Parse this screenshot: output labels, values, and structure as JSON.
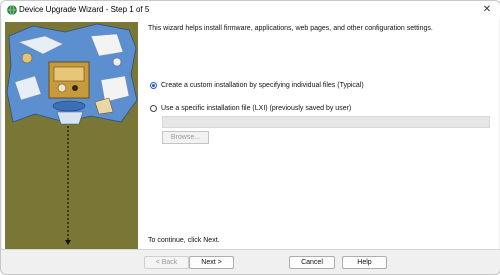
{
  "window": {
    "title": "Device Upgrade Wizard - Step 1 of 5",
    "close_glyph": "✕",
    "title_icon": "globe-icon"
  },
  "main": {
    "intro": "This wizard helps install firmware, applications, web pages, and other configuration settings.",
    "options": [
      {
        "label": "Create a custom installation by specifying individual files (Typical)",
        "checked": true
      },
      {
        "label": "Use a specific installation file (LXI) (previously saved by user)",
        "checked": false
      }
    ],
    "file_value": "",
    "browse_label": "Browse...",
    "continue_text": "To continue, click Next."
  },
  "footer": {
    "back_label": "< Back",
    "next_label": "Next >",
    "cancel_label": "Cancel",
    "help_label": "Help"
  },
  "colors": {
    "side_panel": "#7a7636",
    "accent": "#1f5fbf"
  }
}
